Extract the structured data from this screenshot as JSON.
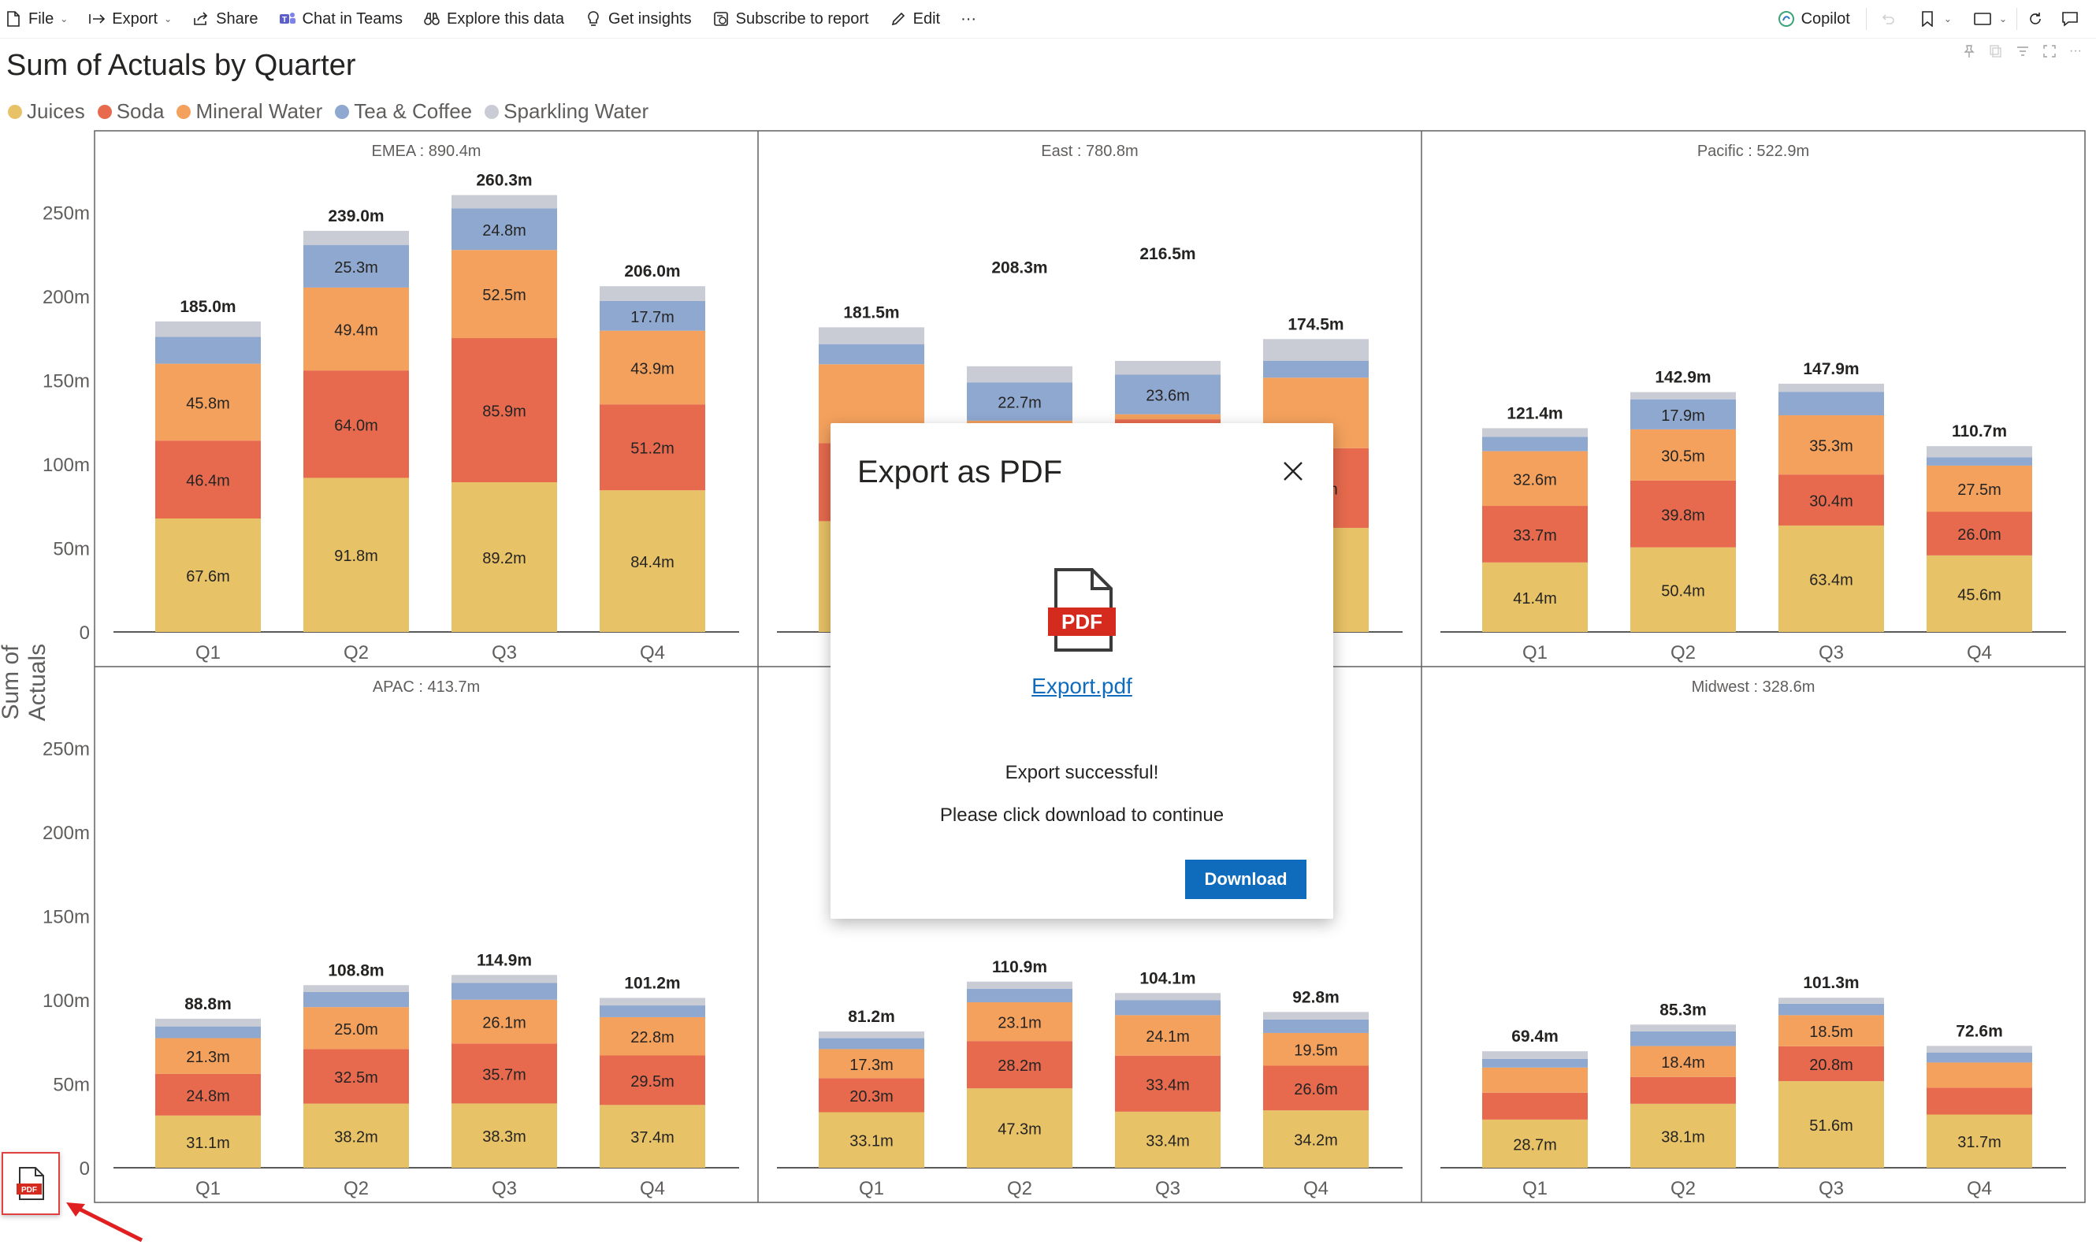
{
  "toolbar": {
    "file": "File",
    "export": "Export",
    "share": "Share",
    "chat": "Chat in Teams",
    "explore": "Explore this data",
    "insights": "Get insights",
    "subscribe": "Subscribe to report",
    "edit": "Edit",
    "more": "···",
    "copilot": "Copilot"
  },
  "visual": {
    "title": "Sum of Actuals by Quarter",
    "ylabel": "Sum of Actuals"
  },
  "legend": [
    {
      "name": "Juices",
      "color": "#e8c266"
    },
    {
      "name": "Soda",
      "color": "#e76a4e"
    },
    {
      "name": "Mineral Water",
      "color": "#f4a15d"
    },
    {
      "name": "Tea & Coffee",
      "color": "#8fa8d0"
    },
    {
      "name": "Sparkling Water",
      "color": "#c9ccd4"
    }
  ],
  "chart_data": {
    "type": "bar",
    "stacked": true,
    "title": "Sum of Actuals by Quarter",
    "ylabel": "Sum of Actuals",
    "yticks": [
      "0",
      "50m",
      "100m",
      "150m",
      "200m",
      "250m"
    ],
    "ylim": [
      0,
      280
    ],
    "categories": [
      "Q1",
      "Q2",
      "Q3",
      "Q4"
    ],
    "series_order": [
      "Juices",
      "Soda",
      "Mineral Water",
      "Tea & Coffee",
      "Sparkling Water"
    ],
    "panels": [
      {
        "region": "EMEA",
        "total": "890.4m",
        "bars": [
          {
            "total": 185.0,
            "label": "185.0m",
            "values": [
              67.6,
              46.4,
              45.8,
              16.0,
              9.2
            ],
            "show": [
              true,
              true,
              true,
              false,
              false
            ]
          },
          {
            "total": 239.0,
            "label": "239.0m",
            "values": [
              91.8,
              64.0,
              49.4,
              25.3,
              8.5
            ],
            "show": [
              true,
              true,
              true,
              true,
              false
            ]
          },
          {
            "total": 260.3,
            "label": "260.3m",
            "values": [
              89.2,
              85.9,
              52.5,
              24.8,
              7.9
            ],
            "show": [
              true,
              true,
              true,
              true,
              false
            ]
          },
          {
            "total": 206.0,
            "label": "206.0m",
            "values": [
              84.4,
              51.2,
              43.9,
              17.7,
              8.8
            ],
            "show": [
              true,
              true,
              true,
              true,
              false
            ]
          }
        ]
      },
      {
        "region": "East",
        "total": "780.8m",
        "bars": [
          {
            "total": 181.5,
            "label": "181.5m",
            "values": [
              66.0,
              46.5,
              47.0,
              12.0,
              10.0
            ],
            "show": [
              false,
              true,
              false,
              false,
              false
            ]
          },
          {
            "total": 208.3,
            "label": "208.3m",
            "values": [
              73.0,
              44.9,
              8.0,
              22.7,
              9.7
            ],
            "show": [
              false,
              true,
              false,
              true,
              false
            ]
          },
          {
            "total": 216.5,
            "label": "216.5m",
            "values": [
              70.0,
              56.7,
              3.0,
              23.6,
              8.2
            ],
            "show": [
              false,
              true,
              false,
              true,
              false
            ]
          },
          {
            "total": 174.5,
            "label": "174.5m",
            "values": [
              62.0,
              47.5,
              42.0,
              10.0,
              13.0
            ],
            "show": [
              false,
              true,
              false,
              false,
              false
            ]
          }
        ]
      },
      {
        "region": "Pacific",
        "total": "522.9m",
        "bars": [
          {
            "total": 121.4,
            "label": "121.4m",
            "values": [
              41.4,
              33.7,
              32.6,
              8.6,
              5.1
            ],
            "show": [
              true,
              true,
              true,
              false,
              false
            ]
          },
          {
            "total": 142.9,
            "label": "142.9m",
            "values": [
              50.4,
              39.8,
              30.5,
              17.9,
              4.3
            ],
            "show": [
              true,
              true,
              true,
              true,
              false
            ]
          },
          {
            "total": 147.9,
            "label": "147.9m",
            "values": [
              63.4,
              30.4,
              35.3,
              14.0,
              4.8
            ],
            "show": [
              true,
              true,
              true,
              false,
              false
            ]
          },
          {
            "total": 110.7,
            "label": "110.7m",
            "values": [
              45.6,
              26.0,
              27.5,
              5.0,
              6.6
            ],
            "show": [
              true,
              true,
              true,
              false,
              false
            ]
          }
        ]
      },
      {
        "region": "APAC",
        "total": "413.7m",
        "bars": [
          {
            "total": 88.8,
            "label": "88.8m",
            "values": [
              31.1,
              24.8,
              21.3,
              7.0,
              4.6
            ],
            "show": [
              true,
              true,
              true,
              false,
              false
            ]
          },
          {
            "total": 108.8,
            "label": "108.8m",
            "values": [
              38.2,
              32.5,
              25.0,
              9.0,
              4.1
            ],
            "show": [
              true,
              true,
              true,
              false,
              false
            ]
          },
          {
            "total": 114.9,
            "label": "114.9m",
            "values": [
              38.3,
              35.7,
              26.1,
              10.0,
              4.8
            ],
            "show": [
              true,
              true,
              true,
              false,
              false
            ]
          },
          {
            "total": 101.2,
            "label": "101.2m",
            "values": [
              37.4,
              29.5,
              22.8,
              7.0,
              4.5
            ],
            "show": [
              true,
              true,
              true,
              false,
              false
            ]
          }
        ]
      },
      {
        "region": "",
        "total": "",
        "bars": [
          {
            "total": 81.2,
            "label": "81.2m",
            "values": [
              33.1,
              20.3,
              17.3,
              6.5,
              4.0
            ],
            "show": [
              true,
              true,
              true,
              false,
              false
            ]
          },
          {
            "total": 110.9,
            "label": "110.9m",
            "values": [
              47.3,
              28.2,
              23.1,
              8.0,
              4.3
            ],
            "show": [
              true,
              true,
              true,
              false,
              false
            ]
          },
          {
            "total": 104.1,
            "label": "104.1m",
            "values": [
              33.4,
              33.4,
              24.1,
              9.0,
              4.2
            ],
            "show": [
              true,
              true,
              true,
              false,
              false
            ]
          },
          {
            "total": 92.8,
            "label": "92.8m",
            "values": [
              34.2,
              26.6,
              19.5,
              8.0,
              4.5
            ],
            "show": [
              true,
              true,
              true,
              false,
              false
            ]
          }
        ]
      },
      {
        "region": "Midwest",
        "total": "328.6m",
        "bars": [
          {
            "total": 69.4,
            "label": "69.4m",
            "values": [
              28.7,
              16.0,
              15.0,
              5.2,
              4.5
            ],
            "show": [
              true,
              false,
              false,
              false,
              false
            ]
          },
          {
            "total": 85.3,
            "label": "85.3m",
            "values": [
              38.1,
              16.0,
              18.4,
              8.8,
              4.0
            ],
            "show": [
              true,
              false,
              true,
              false,
              false
            ]
          },
          {
            "total": 101.3,
            "label": "101.3m",
            "values": [
              51.6,
              20.8,
              18.5,
              6.8,
              3.6
            ],
            "show": [
              true,
              true,
              true,
              false,
              false
            ]
          },
          {
            "total": 72.6,
            "label": "72.6m",
            "values": [
              31.7,
              16.0,
              15.0,
              6.0,
              3.9
            ],
            "show": [
              true,
              false,
              false,
              false,
              false
            ]
          }
        ]
      }
    ]
  },
  "dialog": {
    "title": "Export as PDF",
    "file_link": "Export.pdf",
    "file_badge": "PDF",
    "message1": "Export successful!",
    "message2": "Please click download to continue",
    "download": "Download"
  },
  "floating": {
    "pdf_badge": "PDF"
  }
}
